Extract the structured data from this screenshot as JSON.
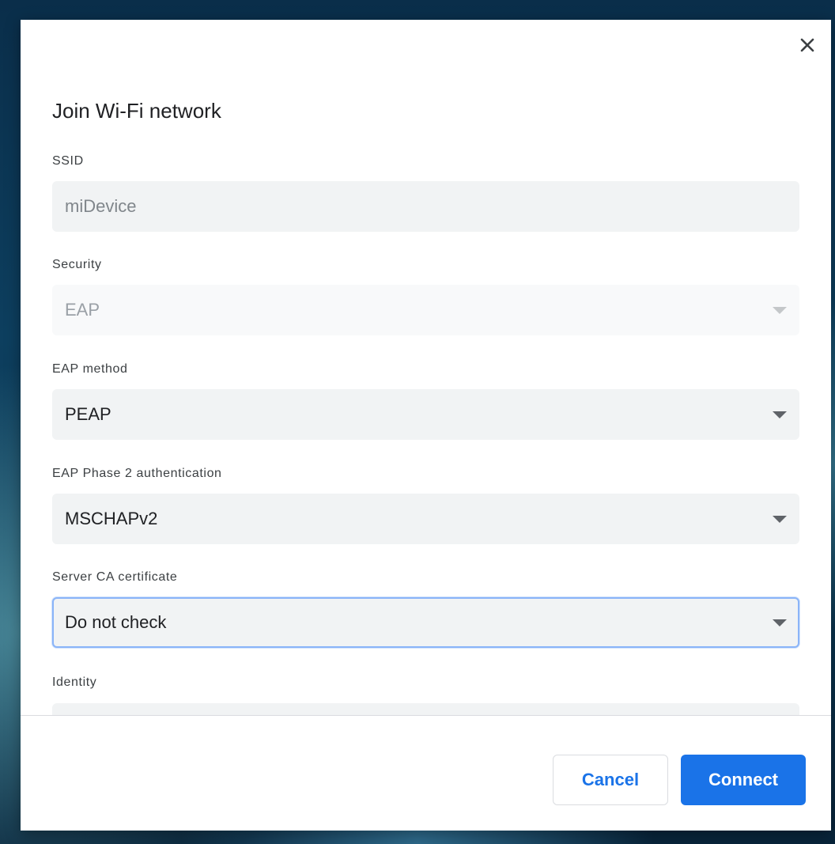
{
  "dialog": {
    "title": "Join Wi-Fi network",
    "close_icon": "close-icon"
  },
  "fields": {
    "ssid": {
      "label": "SSID",
      "value": "miDevice"
    },
    "security": {
      "label": "Security",
      "value": "EAP"
    },
    "eap_method": {
      "label": "EAP method",
      "value": "PEAP"
    },
    "phase2": {
      "label": "EAP Phase 2 authentication",
      "value": "MSCHAPv2"
    },
    "server_ca": {
      "label": "Server CA certificate",
      "value": "Do not check"
    },
    "identity": {
      "label": "Identity",
      "value": ""
    }
  },
  "buttons": {
    "cancel": "Cancel",
    "connect": "Connect"
  },
  "colors": {
    "accent": "#1a73e8",
    "focus_ring": "#8ab4f8",
    "field_bg": "#f1f3f4"
  }
}
